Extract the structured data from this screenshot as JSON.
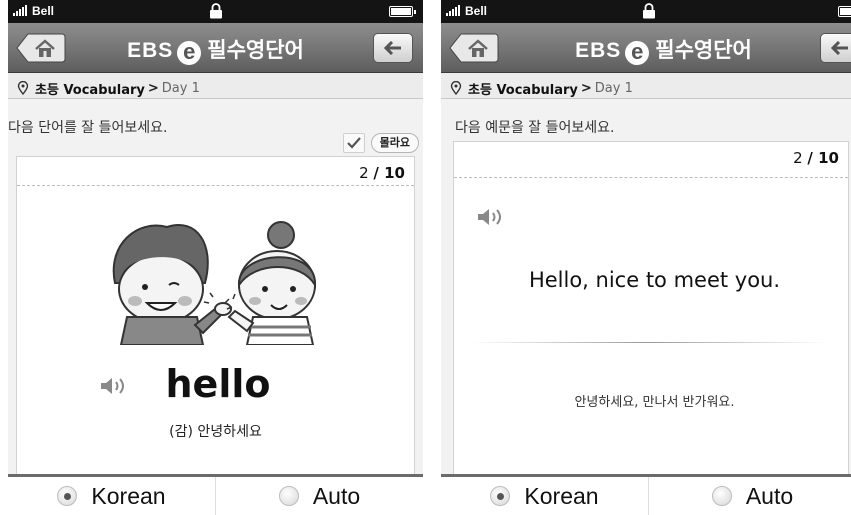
{
  "status_bar": {
    "carrier": "Bell"
  },
  "header": {
    "title_brand": "EBS",
    "title_logo": "e",
    "title_text": "필수영단어"
  },
  "breadcrumb": {
    "level1": "초등 Vocabulary",
    "level2": "Day 1"
  },
  "screens": {
    "word": {
      "instruction": "다음 단어를 잘 들어보세요.",
      "dont_know_label": "몰라요",
      "counter_current": "2",
      "counter_total": "/ 10",
      "word": "hello",
      "meaning": "(감) 안녕하세요"
    },
    "sentence": {
      "instruction": "다음 예문을 잘 들어보세요.",
      "counter_current": "2",
      "counter_total": "/ 10",
      "sentence": "Hello, nice to meet you.",
      "translation": "안녕하세요, 만나서 반가워요."
    }
  },
  "footer": {
    "options": [
      {
        "label": "Korean",
        "selected": true
      },
      {
        "label": "Auto",
        "selected": false
      }
    ]
  },
  "icons": [
    "signal-icon",
    "lock-icon",
    "battery-icon",
    "home-icon",
    "back-arrow-icon",
    "location-pin-icon",
    "checkmark-icon",
    "speaker-icon"
  ]
}
